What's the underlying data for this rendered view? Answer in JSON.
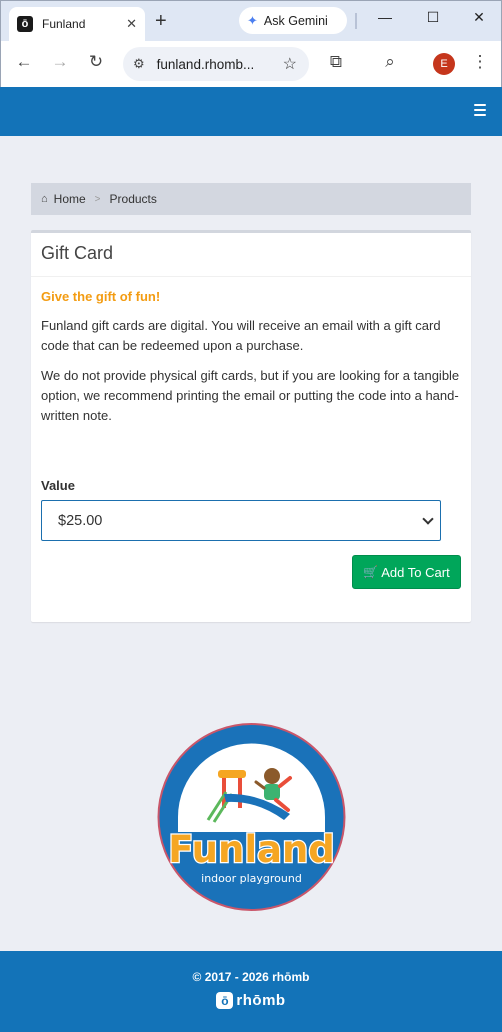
{
  "browser": {
    "tab_title": "Funland",
    "tab_favicon_letter": "ō",
    "gemini_label": "Ask Gemini",
    "url": "funland.rhomb...",
    "profile_initial": "E"
  },
  "breadcrumb": {
    "home": "Home",
    "current": "Products"
  },
  "product": {
    "title": "Gift Card",
    "promo": "Give the gift of fun!",
    "description_1": "Funland gift cards are digital. You will receive an email with a gift card code that can be redeemed upon a purchase.",
    "description_2": "We do not provide physical gift cards, but if you are looking for a tangible option, we recommend printing the email or putting the code into a hand-written note.",
    "value_label": "Value",
    "value_selected": "$25.00",
    "add_to_cart": "Add To Cart"
  },
  "logo": {
    "wordmark": "Funland",
    "tagline": "indoor playground"
  },
  "footer": {
    "copyright": "© 2017 - 2026 rhōmb",
    "brand": "rhōmb"
  },
  "colors": {
    "brand_blue": "#1373b8",
    "promo_orange": "#f39c12",
    "cart_green": "#00a65a"
  }
}
